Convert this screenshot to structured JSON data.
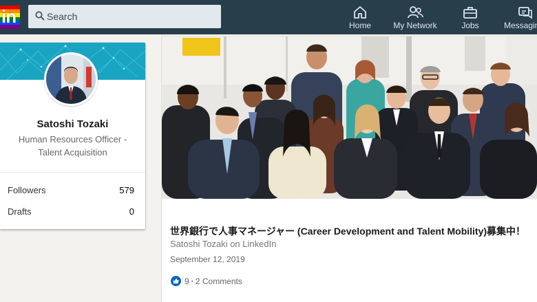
{
  "nav": {
    "search_placeholder": "Search",
    "items": [
      {
        "label": "Home",
        "icon": "home-icon"
      },
      {
        "label": "My Network",
        "icon": "network-icon"
      },
      {
        "label": "Jobs",
        "icon": "briefcase-icon"
      },
      {
        "label": "Messaging",
        "icon": "messaging-icon"
      }
    ]
  },
  "profile": {
    "name": "Satoshi Tozaki",
    "headline": "Human Resources Officer - Talent Acquisition",
    "stats": [
      {
        "label": "Followers",
        "value": "579"
      },
      {
        "label": "Drafts",
        "value": "0"
      }
    ]
  },
  "article": {
    "title": "世界銀行で人事マネージャー (Career Development and Talent Mobility)募集中！",
    "author": "Satoshi Tozaki on LinkedIn",
    "date": "September 12, 2019",
    "likes": "9",
    "separator": "•",
    "comments": "2 Comments"
  },
  "colors": {
    "topbar": "#283e4a",
    "search_bg": "#e1e9ee",
    "cover": "#1aa4c0",
    "like": "#0a66c2"
  }
}
